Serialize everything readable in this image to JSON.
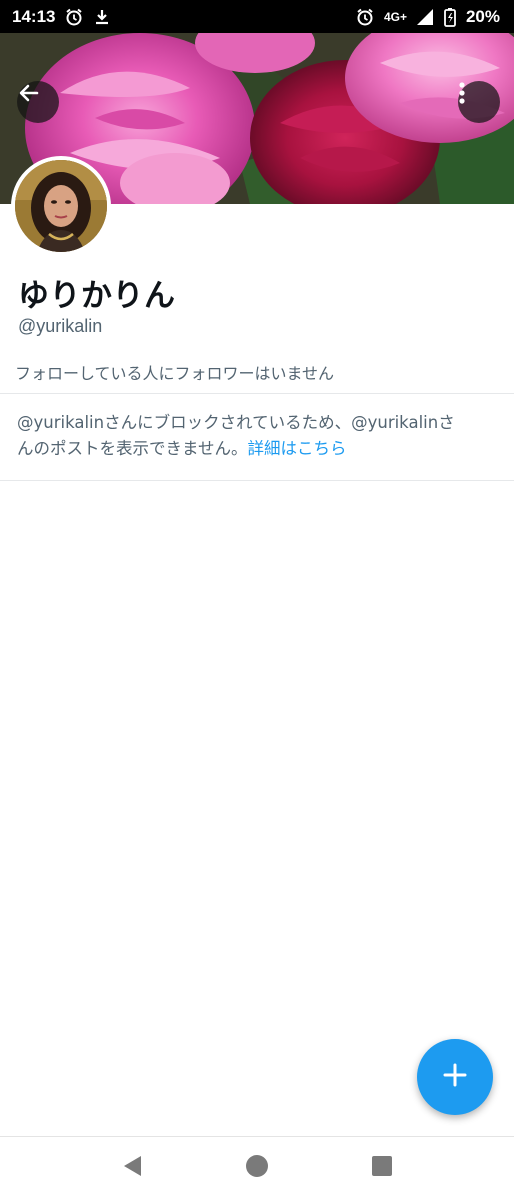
{
  "status_bar": {
    "time": "14:13",
    "network": "4G+",
    "battery_percent": "20%",
    "icons_left": [
      "alarm-icon",
      "download-icon"
    ],
    "icons_right": [
      "alarm-icon",
      "signal-icon",
      "battery-charging-icon"
    ]
  },
  "profile": {
    "display_name": "ゆりかりん",
    "handle": "@yurikalin",
    "follow_note": "フォローしている人にフォロワーはいません"
  },
  "block_notice": {
    "line1": "@yurikalinさんにブロックされているため、@yurikalinさ",
    "line2_prefix": "んのポストを表示できません。",
    "link": "詳細はこちら"
  },
  "buttons": {
    "back": "arrow-left-icon",
    "more": "more-vertical-icon",
    "compose": "plus-icon"
  },
  "nav": [
    "back-triangle-icon",
    "home-circle-icon",
    "recents-square-icon"
  ],
  "colors": {
    "accent": "#1d9bf0",
    "text_primary": "#0f1419",
    "text_secondary": "#536471"
  }
}
